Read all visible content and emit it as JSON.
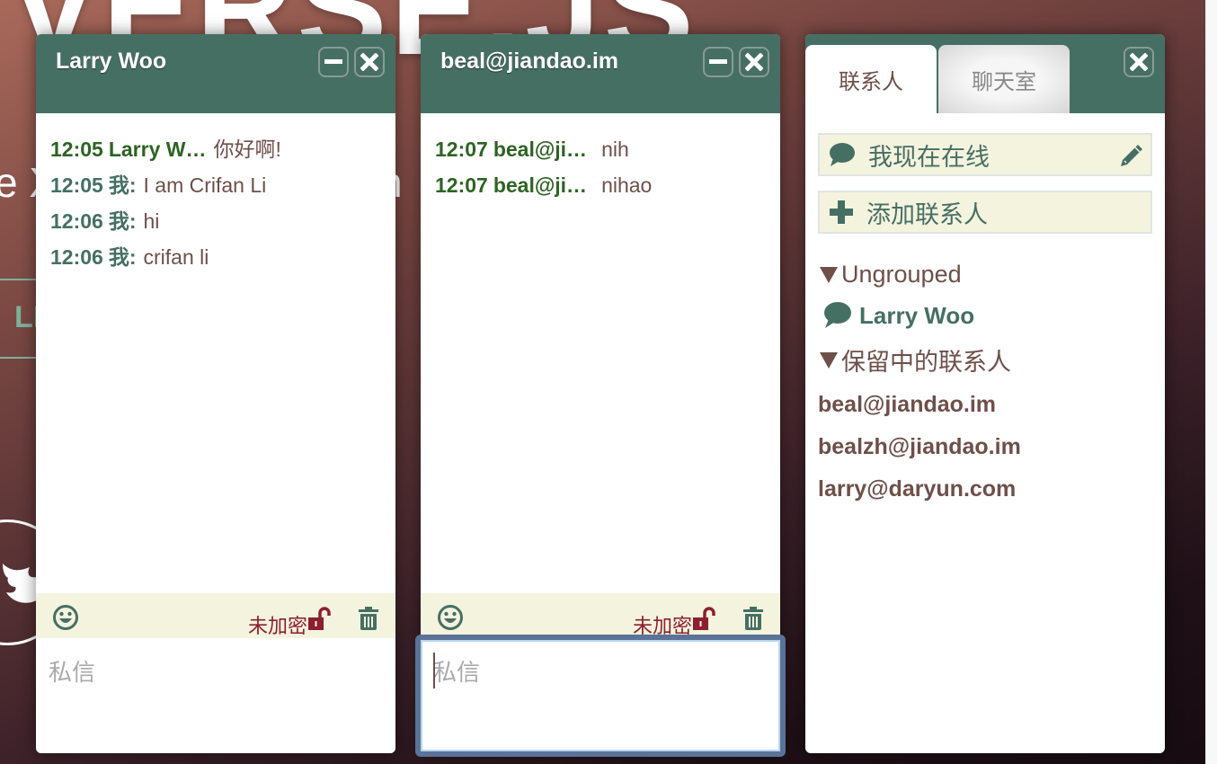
{
  "background": {
    "logo_text": "VERSE.JS",
    "tagline_start": "e X",
    "tagline_end": "n",
    "nav_text": "LI"
  },
  "colors": {
    "header_green": "#466f64",
    "their_name_green": "#2e6323",
    "my_name_green": "#466f64",
    "body_text_brown": "#6e4f49",
    "toolbar_bg": "#f4f3de",
    "unencrypted_red": "#8b1f2f",
    "focus_ring_blue": "#5a7397"
  },
  "chats": [
    {
      "title": "Larry Woo",
      "minimize_icon": "minus-icon",
      "close_icon": "close-icon",
      "messages": [
        {
          "time": "12:05",
          "sender": "Larry W…",
          "body": "你好啊!",
          "from": "them"
        },
        {
          "time": "12:05",
          "sender": "我:",
          "body": "I am Crifan Li",
          "from": "me"
        },
        {
          "time": "12:06",
          "sender": "我:",
          "body": "hi",
          "from": "me"
        },
        {
          "time": "12:06",
          "sender": "我:",
          "body": "crifan li",
          "from": "me"
        }
      ],
      "toolbar": {
        "emoji_icon": "smiley-icon",
        "otr_status": "未加密",
        "lock_icon": "unlock-icon",
        "trash_icon": "trash-icon"
      },
      "input": {
        "value": "",
        "placeholder": "私信"
      },
      "focused": false
    },
    {
      "title": "beal@jiandao.im",
      "minimize_icon": "minus-icon",
      "close_icon": "close-icon",
      "messages": [
        {
          "time": "12:07",
          "sender": "beal@ji…",
          "body": "nih",
          "from": "them"
        },
        {
          "time": "12:07",
          "sender": "beal@ji…",
          "body": "nihao",
          "from": "them"
        }
      ],
      "toolbar": {
        "emoji_icon": "smiley-icon",
        "otr_status": "未加密",
        "lock_icon": "unlock-icon",
        "trash_icon": "trash-icon"
      },
      "input": {
        "value": "",
        "placeholder": "私信"
      },
      "focused": true
    }
  ],
  "controlbox": {
    "tabs": [
      {
        "label": "联系人",
        "active": true
      },
      {
        "label": "聊天室",
        "active": false
      }
    ],
    "close_icon": "close-icon",
    "status": {
      "icon": "chat-bubble-icon",
      "label": "我现在在线",
      "edit_icon": "pencil-icon"
    },
    "add_contact": {
      "icon": "plus-icon",
      "label": "添加联系人"
    },
    "groups": [
      {
        "name": "Ungrouped",
        "contacts": [
          {
            "name": "Larry Woo",
            "status": "online"
          }
        ]
      },
      {
        "name": "保留中的联系人",
        "contacts": [
          {
            "name": "beal@jiandao.im",
            "status": "pending"
          },
          {
            "name": "bealzh@jiandao.im",
            "status": "pending"
          },
          {
            "name": "larry@daryun.com",
            "status": "pending"
          }
        ]
      }
    ]
  }
}
